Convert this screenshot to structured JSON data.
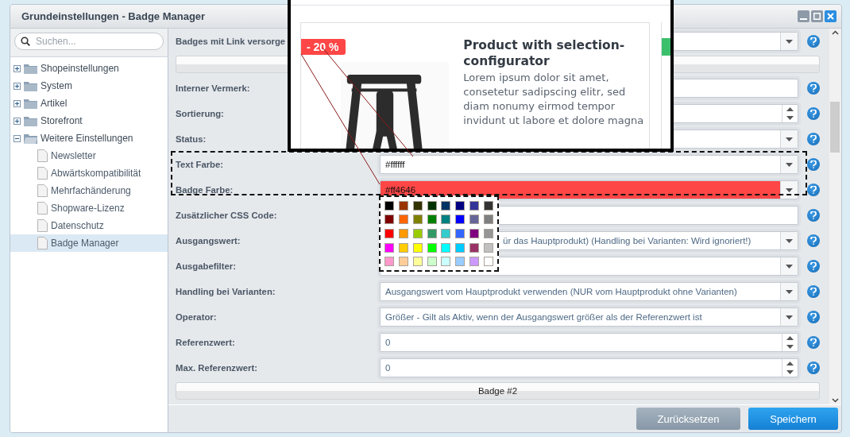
{
  "window": {
    "title": "Grundeinstellungen - Badge Manager"
  },
  "sidebar": {
    "search": {
      "placeholder": "Suchen..."
    },
    "tree": [
      {
        "label": "Shopeinstellungen",
        "expanded": false,
        "selected": false
      },
      {
        "label": "System",
        "expanded": false,
        "selected": false
      },
      {
        "label": "Artikel",
        "expanded": false,
        "selected": false
      },
      {
        "label": "Storefront",
        "expanded": false,
        "selected": false
      },
      {
        "label": "Weitere Einstellungen",
        "expanded": true,
        "selected": false,
        "children": [
          {
            "label": "Newsletter",
            "selected": false
          },
          {
            "label": "Abwärtskompatibilität",
            "selected": false
          },
          {
            "label": "Mehrfachänderung",
            "selected": false
          },
          {
            "label": "Shopware-Lizenz",
            "selected": false
          },
          {
            "label": "Datenschutz",
            "selected": false
          },
          {
            "label": "Badge Manager",
            "selected": true
          }
        ]
      }
    ]
  },
  "form": {
    "items": [
      {
        "kind": "select",
        "label": "Badges mit Link versorge"
      },
      {
        "kind": "section"
      },
      {
        "kind": "text",
        "label": "Interner Vermerk:"
      },
      {
        "kind": "number",
        "label": "Sortierung:"
      },
      {
        "kind": "select",
        "label": "Status:"
      },
      {
        "kind": "color",
        "label": "Text Farbe:",
        "value": "#ffffff"
      },
      {
        "kind": "color",
        "label": "Badge Farbe:",
        "value": "#ff4646",
        "picker": true
      },
      {
        "kind": "text",
        "label": "Zusätzlicher CSS Code:"
      },
      {
        "kind": "select",
        "label": "Ausgangswert:",
        "value": "ür das Hauptprodukt) (Handling bei Varianten: Wird ignoriert!)"
      },
      {
        "kind": "select",
        "label": "Ausgabefilter:"
      },
      {
        "kind": "select",
        "label": "Handling bei Varianten:",
        "value": "Ausgangswert vom Hauptprodukt verwenden (NUR vom Hauptprodukt ohne Varianten)"
      },
      {
        "kind": "select",
        "label": "Operator:",
        "value": "Größer - Gilt als Aktiv, wenn der Ausgangswert größer als der Referenzwert ist"
      },
      {
        "kind": "number",
        "label": "Referenzwert:",
        "value": "0"
      },
      {
        "kind": "number",
        "label": "Max. Referenzwert:",
        "value": "0"
      },
      {
        "kind": "section",
        "label": "Badge #2"
      }
    ]
  },
  "color_picker": {
    "swatches": [
      {
        "color": "#000000"
      },
      {
        "color": "#993300"
      },
      {
        "color": "#333300"
      },
      {
        "color": "#003300"
      },
      {
        "color": "#003366"
      },
      {
        "color": "#000080"
      },
      {
        "color": "#333399"
      },
      {
        "color": "#333333"
      },
      {
        "color": "#800000"
      },
      {
        "color": "#ff6600"
      },
      {
        "color": "#808000"
      },
      {
        "color": "#008000"
      },
      {
        "color": "#008080"
      },
      {
        "color": "#0000ff"
      },
      {
        "color": "#666699"
      },
      {
        "color": "#808080"
      },
      {
        "color": "#ff0000"
      },
      {
        "color": "#ff9900"
      },
      {
        "color": "#99cc00"
      },
      {
        "color": "#339966"
      },
      {
        "color": "#33cccc"
      },
      {
        "color": "#3366ff"
      },
      {
        "color": "#800080"
      },
      {
        "color": "#969696"
      },
      {
        "color": "#ff00ff"
      },
      {
        "color": "#ffcc00"
      },
      {
        "color": "#ffff00"
      },
      {
        "color": "#00ff00"
      },
      {
        "color": "#00ffff"
      },
      {
        "color": "#00ccff"
      },
      {
        "color": "#993366"
      },
      {
        "color": "#c0c0c0"
      },
      {
        "color": "#ff99cc"
      },
      {
        "color": "#ffcc99"
      },
      {
        "color": "#ffff99"
      },
      {
        "color": "#ccffcc"
      },
      {
        "color": "#ccffff"
      },
      {
        "color": "#99ccff"
      },
      {
        "color": "#cc99ff"
      },
      {
        "color": "#ffffff"
      }
    ]
  },
  "preview": {
    "badge": "- 20 %",
    "title": "Product with selection-configurator",
    "text": "Lorem ipsum dolor sit amet, consetetur sadipscing elitr, sed diam nonumy eirmod tempor invidunt ut labore et dolore magna"
  },
  "buttons": [
    {
      "label": "Zurücksetzen",
      "kind": "secondary"
    },
    {
      "label": "Speichern",
      "kind": "primary"
    }
  ]
}
